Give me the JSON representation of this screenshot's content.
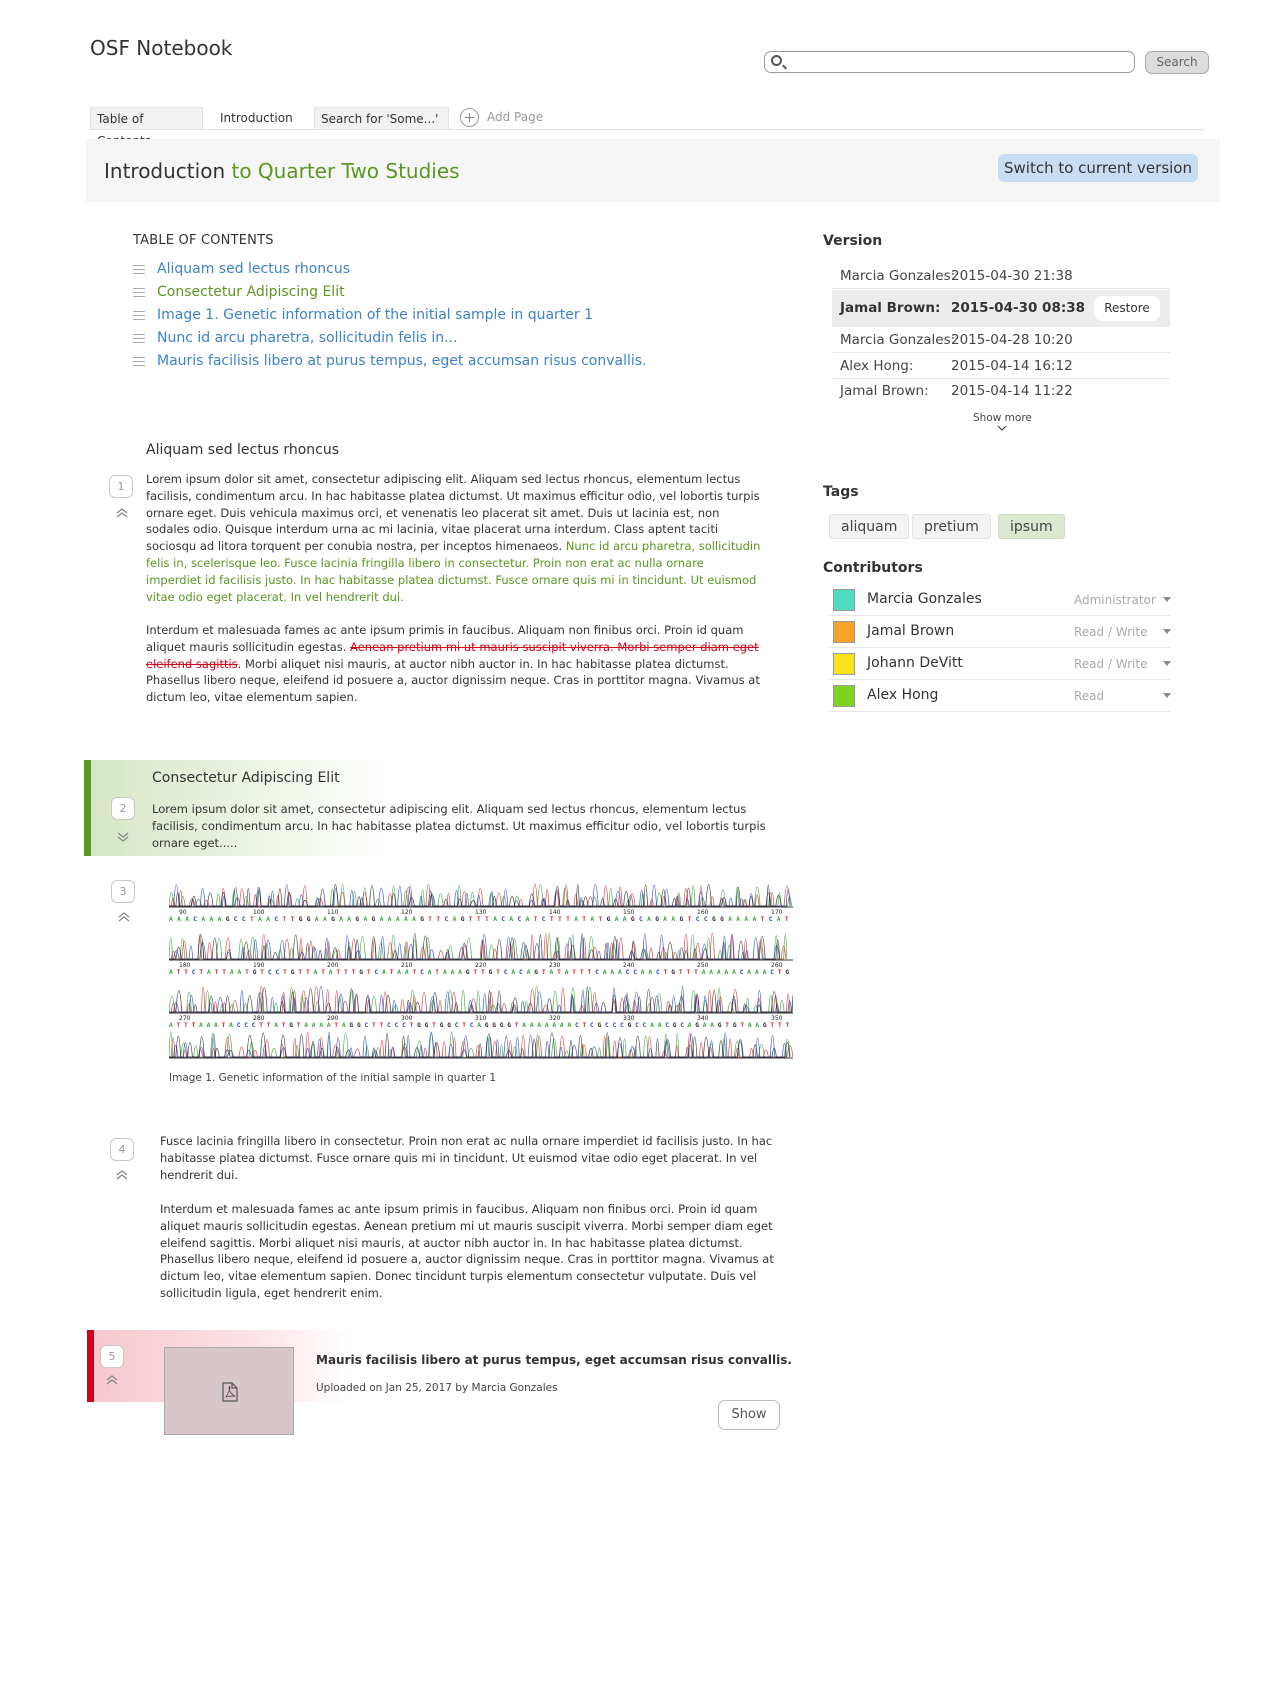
{
  "app": {
    "title": "OSF Notebook"
  },
  "search": {
    "placeholder": "",
    "value": "",
    "button_label": "Search"
  },
  "tabs": [
    {
      "label": "Table of Contents",
      "boxed": true
    },
    {
      "label": "Introduction",
      "boxed": false
    },
    {
      "label": "Search for 'Some...'",
      "boxed": true
    }
  ],
  "add_page": {
    "label": "Add Page"
  },
  "page": {
    "title_main": "Introduction",
    "title_sub": " to Quarter Two Studies",
    "switch_label": "Switch to current version"
  },
  "toc": {
    "heading": "TABLE OF CONTENTS",
    "items": [
      "Aliquam sed lectus rhoncus",
      "Consectetur Adipiscing Elit",
      "Image 1. Genetic information of the initial sample in quarter 1",
      "Nunc id arcu pharetra, sollicitudin felis in...",
      "Mauris facilisis libero at purus tempus, eget accumsan risus convallis."
    ]
  },
  "sections": {
    "s1": {
      "number": "1",
      "title": "Aliquam sed lectus rhoncus",
      "p1_a": "Lorem ipsum dolor sit amet, consectetur adipiscing elit. Aliquam sed lectus rhoncus, elementum lectus facilisis, condimentum arcu. In hac habitasse platea dictumst. Ut maximus efficitur odio, vel lobortis turpis ornare eget. Duis vehicula maximus orci, et venenatis leo placerat sit amet. Duis ut lacinia est, non sodales odio. Quisque interdum urna ac mi lacinia, vitae placerat urna interdum. Class aptent taciti sociosqu ad litora torquent per conubia nostra, per inceptos himenaeos. ",
      "p1_b": "Nunc id arcu pharetra, sollicitudin felis in, scelerisque leo. Fusce lacinia fringilla libero in consectetur. Proin non erat ac nulla ornare imperdiet id facilisis justo. In hac habitasse platea dictumst. Fusce ornare quis mi in tincidunt. Ut euismod vitae odio eget placerat. In vel hendrerit dui.",
      "p2_a": "Interdum et malesuada fames ac ante ipsum primis in faucibus. Aliquam non finibus orci. Proin id quam aliquet mauris sollicitudin egestas. ",
      "p2_b": "Aenean pretium mi ut mauris suscipit viverra. Morbi semper diam eget eleifend sagittis",
      "p2_c": ". Morbi aliquet nisi mauris, at auctor nibh auctor in. In hac habitasse platea dictumst. Phasellus libero neque, eleifend id posuere a, auctor dignissim neque. Cras in porttitor magna. Vivamus at dictum leo, vitae elementum sapien."
    },
    "s2": {
      "number": "2",
      "title": "Consectetur Adipiscing Elit",
      "p1": "Lorem ipsum dolor sit amet, consectetur adipiscing elit. Aliquam sed lectus rhoncus, elementum lectus facilisis, condimentum arcu. In hac habitasse platea dictumst. Ut maximus efficitur odio, vel lobortis turpis ornare eget....."
    },
    "s3": {
      "number": "3",
      "caption": "Image 1. Genetic information of the initial sample in quarter 1"
    },
    "s4": {
      "number": "4",
      "p1": "Fusce lacinia fringilla libero in consectetur. Proin non erat ac nulla ornare imperdiet id facilisis justo. In hac habitasse platea dictumst. Fusce ornare quis mi in tincidunt. Ut euismod vitae odio eget placerat. In vel hendrerit dui.",
      "p2": "Interdum et malesuada fames ac ante ipsum primis in faucibus. Aliquam non finibus orci. Proin id quam aliquet mauris sollicitudin egestas. Aenean pretium mi ut mauris suscipit viverra. Morbi semper diam eget eleifend sagittis. Morbi aliquet nisi mauris, at auctor nibh auctor in. In hac habitasse platea dictumst. Phasellus libero neque, eleifend id posuere a, auctor dignissim neque. Cras in porttitor magna. Vivamus at dictum leo, vitae elementum sapien. Donec tincidunt turpis elementum consectetur vulputate. Duis vel sollicitudin ligula, eget hendrerit enim."
    },
    "s5": {
      "number": "5",
      "file_title": "Mauris facilisis libero at purus tempus, eget accumsan risus convallis.",
      "file_meta": "Uploaded on Jan 25, 2017 by Marcia Gonzales",
      "show_label": "Show"
    }
  },
  "dna_ticks": {
    "row1": [
      "90",
      "100",
      "110",
      "120",
      "130",
      "140",
      "150",
      "160",
      "170"
    ],
    "row2": [
      "180",
      "190",
      "200",
      "210",
      "220",
      "230",
      "240",
      "250",
      "260"
    ],
    "row3": [
      "270",
      "280",
      "290",
      "300",
      "310",
      "320",
      "330",
      "340",
      "350"
    ],
    "seq1": "AAACAAAGCCTAACTTGGAAGAAGAGAAAAAGTTCAGTTTACACATCTTTATATGAAGCAGAAGTCCGGAAAATCAT",
    "seq2": "ATTCTATTAATGTCCTGTTATATTTGTCATAATCATAAAGTTGTCACAGTATATTTCAAACCAACTGTTTAAAAACAAACTG",
    "seq3": "ATTTAAATACCCTTATGTAAAATAGGCTTCCCTGGTGGCTCAGGGGTAAAAAAACTCGCCCGCCAACGCAGAAGTGTAAGTTT"
  },
  "version": {
    "heading": "Version",
    "rows": [
      {
        "who": "Marcia Gonzales:",
        "when": "2015-04-30 21:38",
        "selected": false
      },
      {
        "who": "Jamal Brown:",
        "when": "2015-04-30 08:38",
        "selected": true
      },
      {
        "who": "Marcia Gonzales:",
        "when": "2015-04-28 10:20",
        "selected": false
      },
      {
        "who": "Alex Hong:",
        "when": "2015-04-14 16:12",
        "selected": false
      },
      {
        "who": "Jamal Brown:",
        "when": "2015-04-14 11:22",
        "selected": false
      }
    ],
    "restore_label": "Restore",
    "show_more_label": "Show more"
  },
  "tags": {
    "heading": "Tags",
    "items": [
      {
        "label": "aliquam",
        "active": false
      },
      {
        "label": "pretium",
        "active": false
      },
      {
        "label": "ipsum",
        "active": true
      }
    ]
  },
  "contributors": {
    "heading": "Contributors",
    "rows": [
      {
        "name": "Marcia Gonzales",
        "role": "Administrator",
        "color": "#4fdcc0"
      },
      {
        "name": "Jamal Brown",
        "role": "Read / Write",
        "color": "#f5a12a"
      },
      {
        "name": "Johann DeVitt",
        "role": "Read / Write",
        "color": "#f8e11d"
      },
      {
        "name": "Alex Hong",
        "role": "Read",
        "color": "#7ed321"
      }
    ]
  },
  "colors": {
    "link_blue": "#3d82c9",
    "accent_green": "#5a9622",
    "edit_red": "#d0021b",
    "switch_bg": "#c8dcf2"
  }
}
